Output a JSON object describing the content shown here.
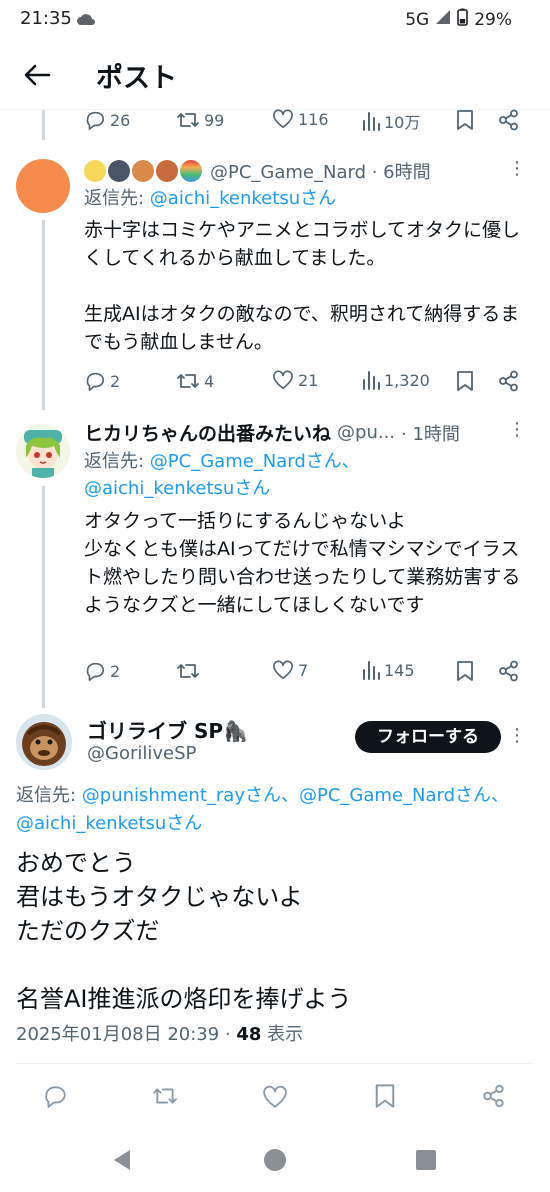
{
  "status": {
    "time": "21:35",
    "network": "5G",
    "battery": "29%"
  },
  "header": {
    "title": "ポスト"
  },
  "prev_tweet_stats": {
    "replies": "26",
    "retweets": "99",
    "likes": "116",
    "views": "10万"
  },
  "tweet1": {
    "handle_time": "@PC_Game_Nard · 6時間",
    "reply_label": "返信先: ",
    "reply_to": "@aichi_kenketsuさん",
    "body": "赤十字はコミケやアニメとコラボしてオタクに優しくしてくれるから献血してました。\n\n生成AIはオタクの敵なので、釈明されて納得するまでもう献血しません。",
    "replies": "2",
    "retweets": "4",
    "likes": "21",
    "views": "1,320"
  },
  "tweet2": {
    "name": "ヒカリちゃんの出番みたいね",
    "handle": "@pu...",
    "time": "· 1時間",
    "reply_label": "返信先: ",
    "reply_to_1": "@PC_Game_Nardさん、",
    "reply_to_2": "@aichi_kenketsuさん",
    "body": "オタクって一括りにするんじゃないよ\n少なくとも僕はAIってだけで私情マシマシでイラスト燃やしたり問い合わせ送ったりして業務妨害するようなクズと一緒にしてほしくないです",
    "replies": "2",
    "retweets": "",
    "likes": "7",
    "views": "145"
  },
  "main_tweet": {
    "name": "ゴリライブ SP🦍",
    "handle": "@GoriliveSP",
    "follow_label": "フォローする",
    "reply_label": "返信先: ",
    "reply_to_1": "@punishment_rayさん、",
    "reply_to_2": "@PC_Game_Nardさん、",
    "reply_to_3": "@aichi_kenketsuさん",
    "body": "おめでとう\n君はもうオタクじゃないよ\nただのクズだ\n\n名誉AI推進派の烙印を捧げよう",
    "timestamp": "2025年01月08日 20:39 · ",
    "views_count": "48",
    "views_label": " 表示"
  },
  "colors": {
    "accent": "#1d9bf0",
    "text": "#0f1419",
    "muted": "#536471"
  }
}
